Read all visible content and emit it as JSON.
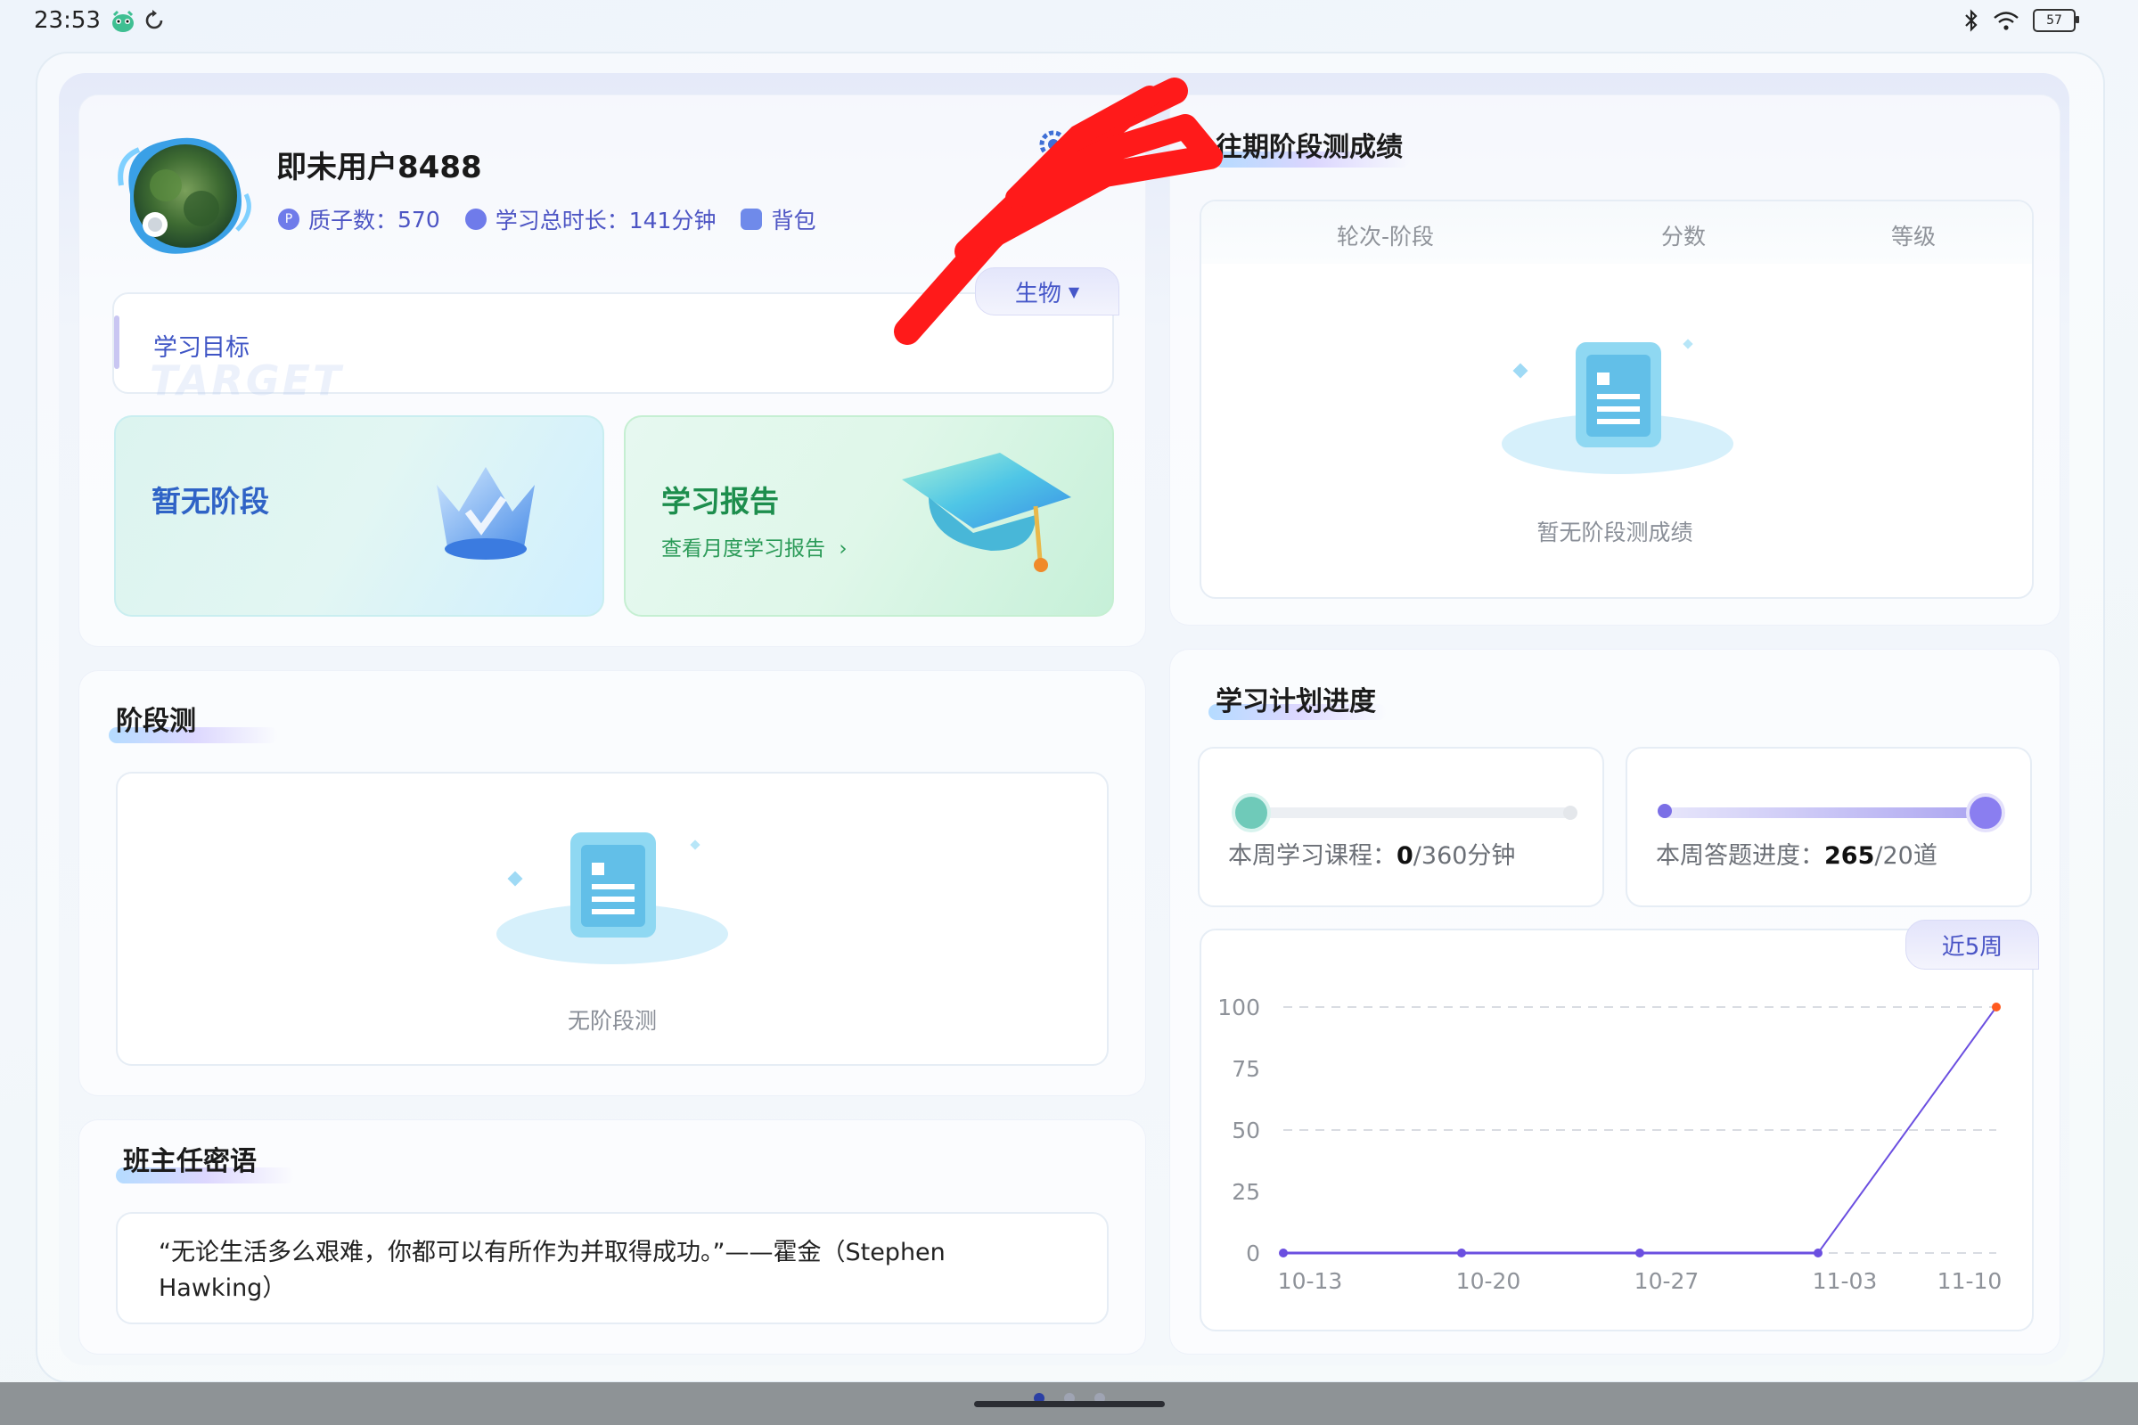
{
  "status_bar": {
    "time": "23:53",
    "battery": "57"
  },
  "profile": {
    "username": "即未用户8488",
    "quantum_label": "质子数：",
    "quantum_value": "570",
    "duration_label": "学习总时长：",
    "duration_value": "141分钟",
    "backpack_label": "背包"
  },
  "goal": {
    "label": "学习目标",
    "watermark": "TARGET",
    "subject": "生物"
  },
  "stage_card": {
    "title": "暂无阶段"
  },
  "report_card": {
    "title": "学习报告",
    "link": "查看月度学习报告"
  },
  "stage_test": {
    "title": "阶段测",
    "empty": "无阶段测"
  },
  "teacher_message": {
    "title": "班主任密语",
    "quote": "“无论生活多么艰难，你都可以有所作为并取得成功。”——霍金（Stephen Hawking）"
  },
  "past_scores": {
    "title": "往期阶段测成绩",
    "columns": [
      "轮次-阶段",
      "分数",
      "等级"
    ],
    "empty": "暂无阶段测成绩"
  },
  "plan_progress": {
    "title": "学习计划进度",
    "course": {
      "label": "本周学习课程：",
      "value": "0",
      "total": "/360分钟",
      "fraction": 0
    },
    "quiz": {
      "label": "本周答题进度：",
      "value": "265",
      "total": "/20道",
      "fraction": 1
    },
    "range_tab": "近5周"
  },
  "chart_data": {
    "type": "line",
    "categories": [
      "10-13",
      "10-20",
      "10-27",
      "11-03",
      "11-10"
    ],
    "values": [
      0,
      0,
      0,
      0,
      100
    ],
    "y_ticks": [
      "100",
      "75",
      "50",
      "25",
      "0"
    ],
    "ylim": [
      0,
      100
    ],
    "grid": true,
    "colors": {
      "line": "#6b4fe0",
      "last_point": "#ff5a1f",
      "grid": "#d9dce2"
    }
  },
  "pager": {
    "dots": 3,
    "active": 0
  }
}
